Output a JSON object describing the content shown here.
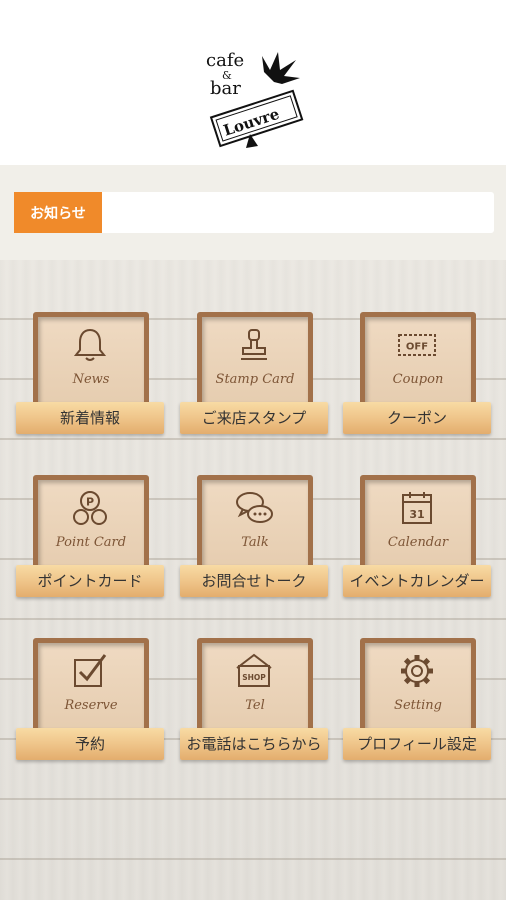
{
  "header": {
    "logo_line1": "cafe",
    "logo_amp": "&",
    "logo_line2": "bar",
    "logo_name": "Louvre"
  },
  "notice": {
    "tag": "お知らせ",
    "text": ""
  },
  "menu": [
    {
      "en": "News",
      "ja": "新着情報",
      "icon": "bell-icon"
    },
    {
      "en": "Stamp Card",
      "ja": "ご来店スタンプ",
      "icon": "stamp-icon"
    },
    {
      "en": "Coupon",
      "ja": "クーポン",
      "icon": "coupon-icon",
      "icon_text": "OFF"
    },
    {
      "en": "Point Card",
      "ja": "ポイントカード",
      "icon": "point-icon",
      "icon_text": "P"
    },
    {
      "en": "Talk",
      "ja": "お問合せトーク",
      "icon": "chat-icon"
    },
    {
      "en": "Calendar",
      "ja": "イベントカレンダー",
      "icon": "calendar-icon",
      "icon_text": "31"
    },
    {
      "en": "Reserve",
      "ja": "予約",
      "icon": "checkbox-icon"
    },
    {
      "en": "Tel",
      "ja": "お電話はこちらから",
      "icon": "shop-icon",
      "icon_text": "SHOP"
    },
    {
      "en": "Setting",
      "ja": "プロフィール設定",
      "icon": "gear-icon"
    }
  ],
  "colors": {
    "notice_tag": "#f08a2a",
    "frame": "#a2714a",
    "plank": "#efc58a",
    "icon": "#6b4a30"
  }
}
